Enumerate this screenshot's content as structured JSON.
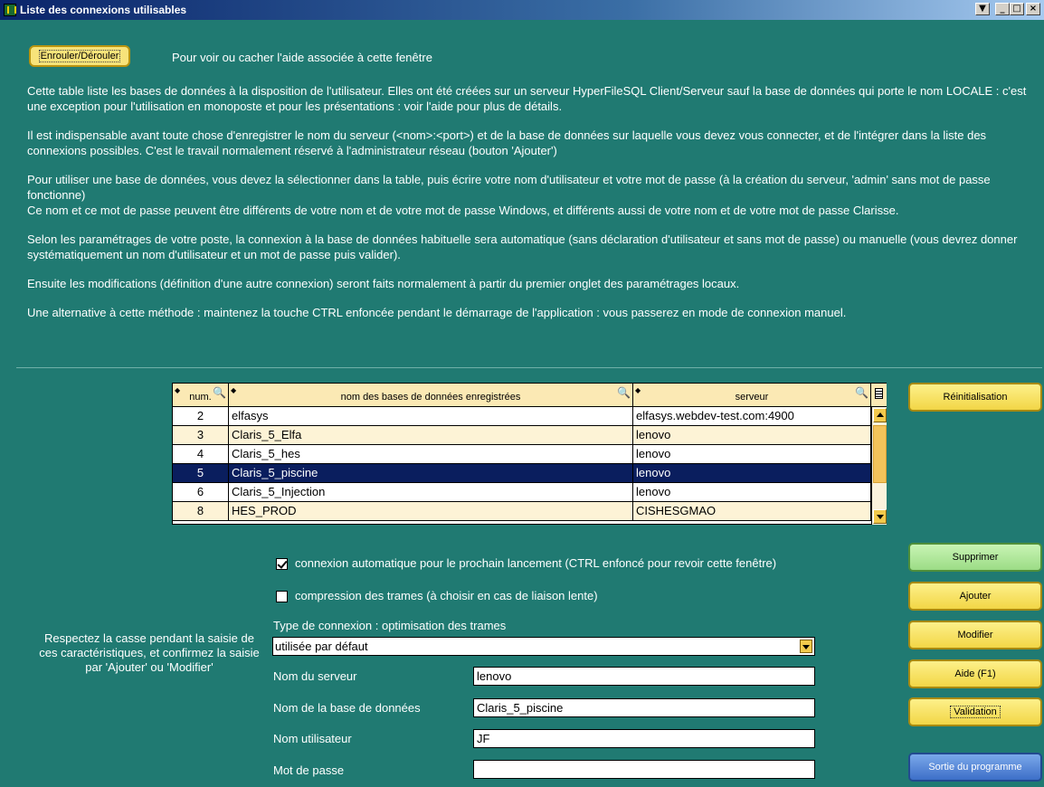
{
  "window": {
    "title": "Liste des connexions utilisables",
    "controls": [
      "▼",
      "_",
      "□",
      "×"
    ]
  },
  "help": {
    "toggle_label": "Enrouler/Dérouler",
    "toggle_caption": "Pour voir ou cacher l'aide associée à cette fenêtre",
    "paragraphs": [
      "Cette table liste les bases de données à la disposition de l'utilisateur. Elles ont été créées sur un serveur HyperFileSQL Client/Serveur sauf la base de données qui porte le nom LOCALE : c'est une exception pour l'utilisation en monoposte et pour les présentations : voir l'aide pour plus de détails.",
      "Il est indispensable avant toute chose d'enregistrer le nom du serveur (<nom>:<port>) et de la base de données sur laquelle vous devez vous connecter, et de l'intégrer dans la liste des connexions possibles. C'est le travail normalement réservé à l'administrateur réseau (bouton 'Ajouter')",
      "Pour utiliser une base de données, vous devez la sélectionner dans la table, puis écrire votre nom d'utilisateur et votre mot de passe (à la création du serveur, 'admin' sans mot de passe fonctionne)\nCe nom et ce mot de passe peuvent être différents de votre nom et de votre mot de passe Windows, et différents aussi de votre nom et de votre mot de passe Clarisse.",
      "Selon les paramétrages de votre poste, la connexion à la base de données habituelle sera automatique (sans déclaration d'utilisateur et sans mot de passe) ou manuelle (vous devrez donner systématiquement un nom d'utilisateur et un mot de passe puis valider).",
      "Ensuite les modifications (définition d'une autre connexion) seront faits normalement à partir du premier onglet des paramétrages locaux.",
      "Une alternative à cette méthode : maintenez la touche CTRL enfoncée pendant le démarrage de l'application : vous passerez en mode de connexion manuel."
    ]
  },
  "table": {
    "columns": [
      "num.",
      "nom des bases de données enregistrées",
      "serveur"
    ],
    "rows": [
      {
        "num": "2",
        "name": "elfasys",
        "server": "elfasys.webdev-test.com:4900"
      },
      {
        "num": "3",
        "name": "Claris_5_Elfa",
        "server": "lenovo"
      },
      {
        "num": "4",
        "name": "Claris_5_hes",
        "server": "lenovo"
      },
      {
        "num": "5",
        "name": "Claris_5_piscine",
        "server": "lenovo"
      },
      {
        "num": "6",
        "name": "Claris_5_Injection",
        "server": "lenovo"
      },
      {
        "num": "8",
        "name": "HES_PROD",
        "server": "CISHESGMAO"
      }
    ],
    "selected_row": 3
  },
  "buttons": {
    "reinit": "Réinitialisation",
    "delete": "Supprimer",
    "add": "Ajouter",
    "modify": "Modifier",
    "help": "Aide (F1)",
    "validate": "Validation",
    "quit": "Sortie du programme"
  },
  "options": {
    "auto_connect": {
      "label": "connexion automatique pour le prochain lancement (CTRL enfoncé pour revoir cette fenêtre)",
      "checked": true
    },
    "compression": {
      "label": "compression des trames (à choisir en cas de liaison lente)",
      "checked": false
    }
  },
  "note": "Respectez la casse pendant la saisie de ces caractéristiques, et confirmez la saisie par 'Ajouter' ou 'Modifier'",
  "form": {
    "type_label": "Type de connexion : optimisation des trames",
    "type_value": "utilisée par défaut",
    "server_label": "Nom du serveur",
    "server_value": "lenovo",
    "db_label": "Nom de la base de données",
    "db_value": "Claris_5_piscine",
    "user_label": "Nom utilisateur",
    "user_value": "JF",
    "password_label": "Mot de passe",
    "password_value": ""
  },
  "colors": {
    "background": "#207a72",
    "header": "#fbe9b4",
    "row_alt": "#fdf3d6",
    "selected": "#0a1e5e",
    "button": "#f6e163"
  }
}
